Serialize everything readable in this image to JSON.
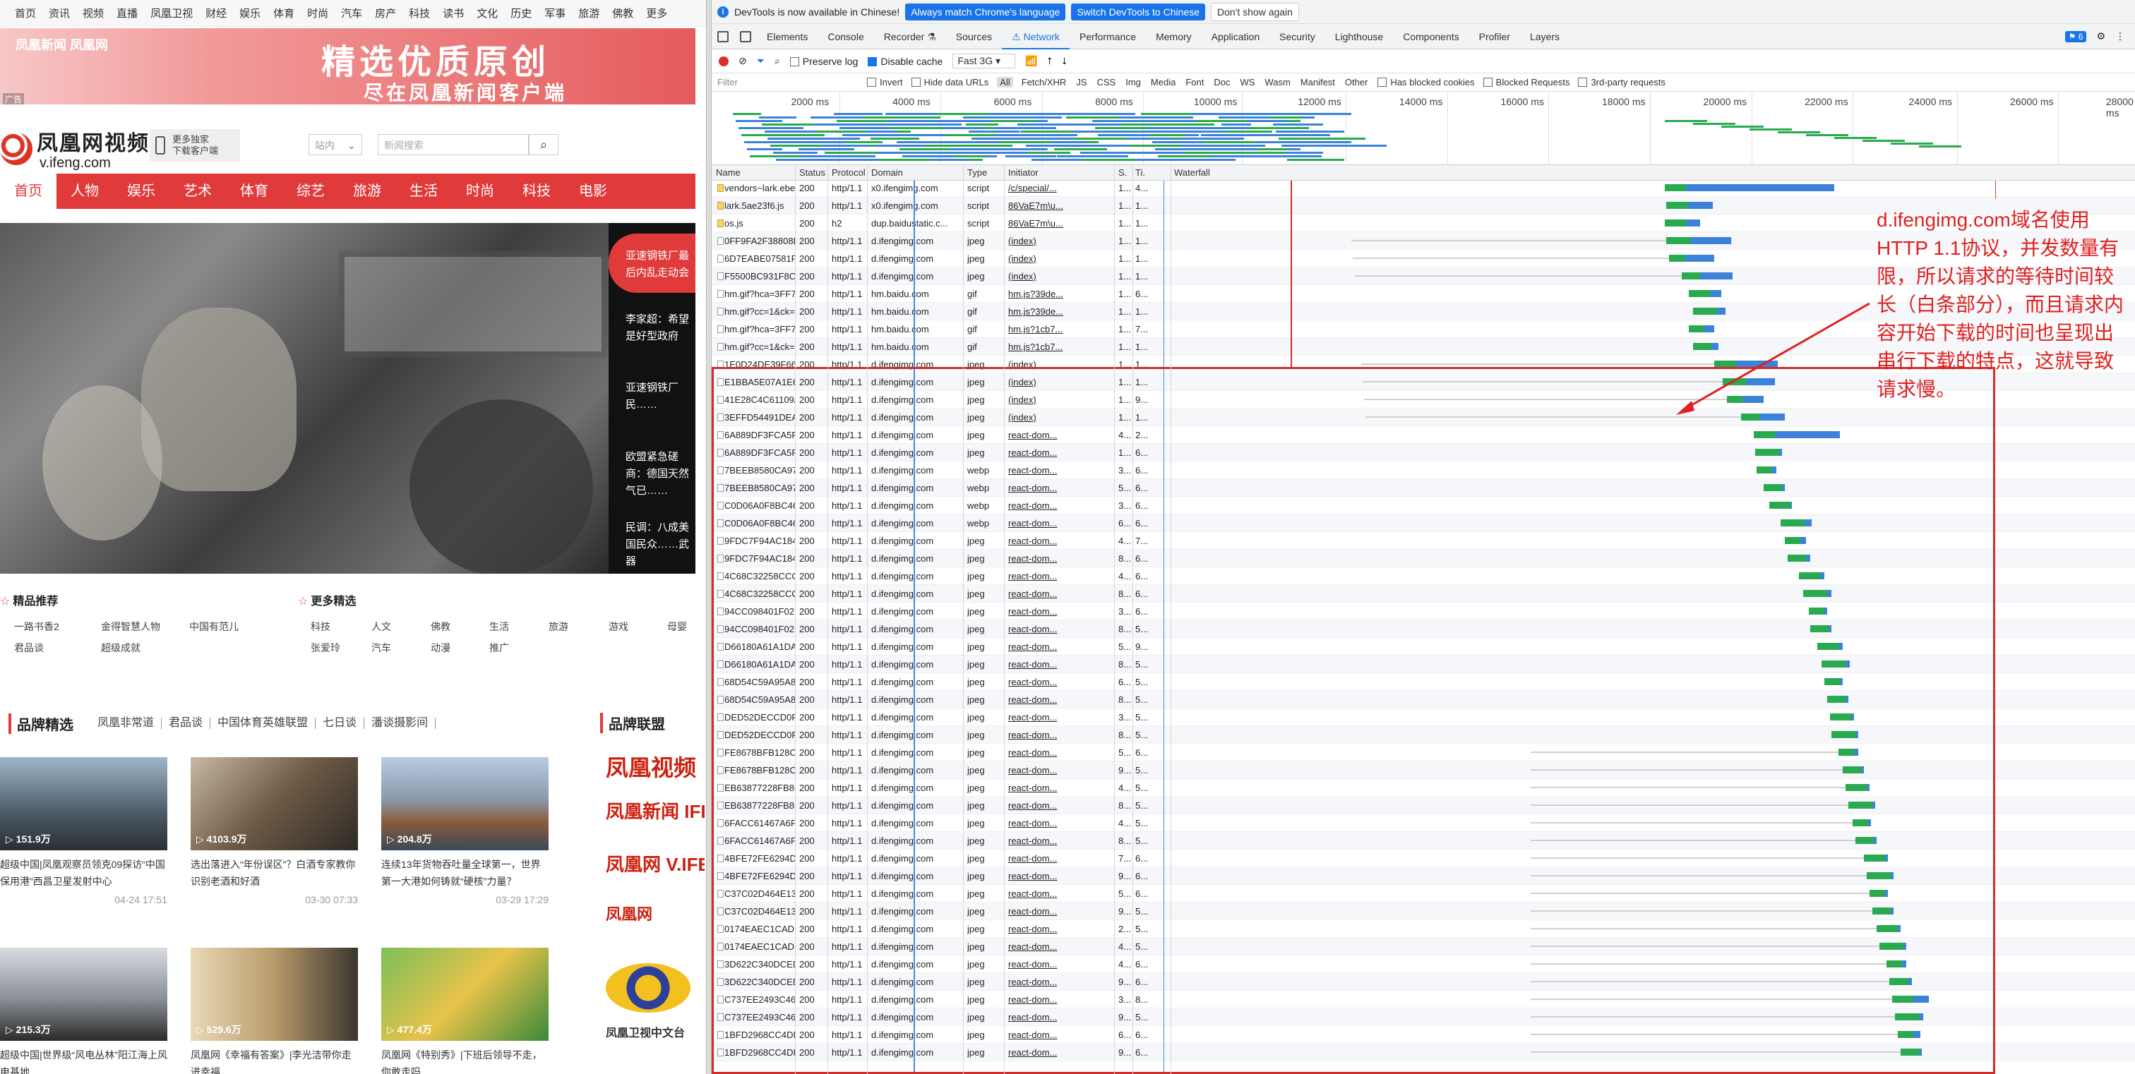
{
  "site": {
    "topnav": [
      "首页",
      "资讯",
      "视频",
      "直播",
      "凤凰卫视",
      "财经",
      "娱乐",
      "体育",
      "时尚",
      "汽车",
      "房产",
      "科技",
      "读书",
      "文化",
      "历史",
      "军事",
      "旅游",
      "佛教",
      "更多"
    ],
    "banner": {
      "left": "凤凰新闻 凤凰网",
      "main": "精选优质原创",
      "sub": "尽在凤凰新闻客户端",
      "ad": "广告"
    },
    "logo": {
      "name": "凤凰网视频",
      "domain": "v.ifeng.com"
    },
    "download": {
      "line1": "更多独家",
      "line2": "下载客户端"
    },
    "site_select": "站内",
    "search_placeholder": "新闻搜索",
    "rednav": [
      "首页",
      "人物",
      "娱乐",
      "艺术",
      "体育",
      "综艺",
      "旅游",
      "生活",
      "时尚",
      "科技",
      "电影"
    ],
    "side_hot": "亚速钢铁厂最后内乱走动会",
    "side_items": [
      "李家超：希望是好型政府",
      "亚速钢铁厂民……",
      "欧盟紧急磋商：德国天然气已……",
      "民调：八成美国民众……武器"
    ],
    "sec_left_title": "精品推荐",
    "sec_left_items": [
      "一路书香2",
      "金得智慧人物",
      "中国有范儿",
      "君品谈",
      "超级成就"
    ],
    "sec_right_title": "更多精选",
    "sec_right_items": [
      "科技",
      "人文",
      "佛教",
      "生活",
      "旅游",
      "游戏",
      "母婴",
      "张爱玲",
      "汽车",
      "动漫",
      "推广"
    ],
    "brand_title": "品牌精选",
    "brand_links": [
      "凤凰非常道",
      "君品谈",
      "中国体育英雄联盟",
      "七日谈",
      "潘谈摄影间"
    ],
    "brand_union": "品牌联盟",
    "cards": [
      {
        "count": "151.9万",
        "cap": "超级中国|凤凰观察员领克09探访“中国保用港”西昌卫星发射中心",
        "date": "04-24 17:51"
      },
      {
        "count": "4103.9万",
        "cap": "选出落进入“年份误区”？白酒专家教你识别老酒和好酒",
        "date": "03-30 07:33"
      },
      {
        "count": "204.8万",
        "cap": "连续13年货物吞吐量全球第一，世界第一大港如何铸就“硬核”力量？",
        "date": "03-29 17:29"
      },
      {
        "count": "215.3万",
        "cap": "超级中国|世界级“风电丛林”阳江海上风电基地",
        "date": ""
      },
      {
        "count": "529.6万",
        "cap": "凤凰网《幸福有答案》|李光洁带你走进幸福",
        "date": ""
      },
      {
        "count": "477.4万",
        "cap": "凤凰网《特别秀》|下班后领导不走，你敢走吗",
        "date": ""
      }
    ],
    "brand_logos": [
      "凤凰视频",
      "凤凰新闻 IFENG NEWS",
      "凤凰网 V.IFENG",
      "凤凰网",
      "凤凰卫视中文台"
    ]
  },
  "devtools": {
    "infobar": {
      "text": "DevTools is now available in Chinese!",
      "btn1": "Always match Chrome's language",
      "btn2": "Switch DevTools to Chinese",
      "btn3": "Don't show again"
    },
    "tabs": [
      "Elements",
      "Console",
      "Recorder ⚗",
      "Sources",
      "⚠ Network",
      "Performance",
      "Memory",
      "Application",
      "Security",
      "Lighthouse",
      "Components",
      "Profiler",
      "Layers"
    ],
    "badge": "6",
    "toolbar": {
      "preserve": "Preserve log",
      "disable": "Disable cache",
      "throttle": "Fast 3G"
    },
    "filter": {
      "placeholder": "Filter",
      "invert": "Invert",
      "hide_data": "Hide data URLs",
      "types": [
        "All",
        "Fetch/XHR",
        "JS",
        "CSS",
        "Img",
        "Media",
        "Font",
        "Doc",
        "WS",
        "Wasm",
        "Manifest",
        "Other"
      ],
      "blocked_cookies": "Has blocked cookies",
      "blocked_requests": "Blocked Requests",
      "third_party": "3rd-party requests"
    },
    "ticks": [
      "2000 ms",
      "4000 ms",
      "6000 ms",
      "8000 ms",
      "10000 ms",
      "12000 ms",
      "14000 ms",
      "16000 ms",
      "18000 ms",
      "20000 ms",
      "22000 ms",
      "24000 ms",
      "26000 ms",
      "28000 ms"
    ],
    "headers": [
      "Name",
      "Status",
      "Protocol",
      "Domain",
      "Type",
      "Initiator",
      "S.",
      "Ti.",
      "Waterfall"
    ],
    "annotation": "d.ifengimg.com域名使用HTTP 1.1协议，并发数量有限，所以请求的等待时间较长（白条部分），而且请求内容开始下载的时间也呈现出串行下载的特点，这就导致请求慢。",
    "rows": [
      [
        "vendors~lark.ebe9673...",
        "200",
        "http/1.1",
        "x0.ifengimg.com",
        "script",
        "/c/special/...",
        "1...",
        "4..."
      ],
      [
        "lark.5ae23f6.js",
        "200",
        "http/1.1",
        "x0.ifengimg.com",
        "script",
        "86VaE7m\\u...",
        "1...",
        "1..."
      ],
      [
        "os.js",
        "200",
        "h2",
        "dup.baidustatic.c...",
        "script",
        "86VaE7m\\u...",
        "1...",
        "1..."
      ],
      [
        "0FF9FA2F38808DA9E8...",
        "200",
        "http/1.1",
        "d.ifengimg.com",
        "jpeg",
        "(index)",
        "1...",
        "1..."
      ],
      [
        "6D7EABE07581FBA65...",
        "200",
        "http/1.1",
        "d.ifengimg.com",
        "jpeg",
        "(index)",
        "1...",
        "1..."
      ],
      [
        "F5500BC931F8CA887...",
        "200",
        "http/1.1",
        "d.ifengimg.com",
        "jpeg",
        "(index)",
        "1...",
        "1..."
      ],
      [
        "hm.gif?hca=3FF7DA1...",
        "200",
        "http/1.1",
        "hm.baidu.com",
        "gif",
        "hm.js?39de...",
        "1...",
        "6..."
      ],
      [
        "hm.gif?cc=1&ck=1&cl...",
        "200",
        "http/1.1",
        "hm.baidu.com",
        "gif",
        "hm.js?39de...",
        "1...",
        "1..."
      ],
      [
        "hm.gif?hca=3FF7DA1...",
        "200",
        "http/1.1",
        "hm.baidu.com",
        "gif",
        "hm.js?1cb7...",
        "1...",
        "7..."
      ],
      [
        "hm.gif?cc=1&ck=1&cl...",
        "200",
        "http/1.1",
        "hm.baidu.com",
        "gif",
        "hm.js?1cb7...",
        "1...",
        "1..."
      ],
      [
        "1E0D24DE39F664A94...",
        "200",
        "http/1.1",
        "d.ifengimg.com",
        "jpeg",
        "(index)",
        "1...",
        "1..."
      ],
      [
        "E1BBA5E07A1E675967...",
        "200",
        "http/1.1",
        "d.ifengimg.com",
        "jpeg",
        "(index)",
        "1...",
        "1..."
      ],
      [
        "41E28C4C61109AF729...",
        "200",
        "http/1.1",
        "d.ifengimg.com",
        "jpeg",
        "(index)",
        "1...",
        "9..."
      ],
      [
        "3EFFD54491DEADC38...",
        "200",
        "http/1.1",
        "d.ifengimg.com",
        "jpeg",
        "(index)",
        "1...",
        "1..."
      ],
      [
        "6A889DF3FCA5F6936...",
        "200",
        "http/1.1",
        "d.ifengimg.com",
        "jpeg",
        "react-dom...",
        "4...",
        "2..."
      ],
      [
        "6A889DF3FCA5F6936...",
        "200",
        "http/1.1",
        "d.ifengimg.com",
        "jpeg",
        "react-dom...",
        "1...",
        "6..."
      ],
      [
        "7BEEB8580CA9790229...",
        "200",
        "http/1.1",
        "d.ifengimg.com",
        "webp",
        "react-dom...",
        "3...",
        "6..."
      ],
      [
        "7BEEB8580CA9790229...",
        "200",
        "http/1.1",
        "d.ifengimg.com",
        "webp",
        "react-dom...",
        "5...",
        "6..."
      ],
      [
        "C0D06A0F8BC4648F8...",
        "200",
        "http/1.1",
        "d.ifengimg.com",
        "webp",
        "react-dom...",
        "3...",
        "6..."
      ],
      [
        "C0D06A0F8BC4648F8...",
        "200",
        "http/1.1",
        "d.ifengimg.com",
        "webp",
        "react-dom...",
        "6...",
        "6..."
      ],
      [
        "9FDC7F94AC184CA42...",
        "200",
        "http/1.1",
        "d.ifengimg.com",
        "jpeg",
        "react-dom...",
        "4...",
        "7..."
      ],
      [
        "9FDC7F94AC184CA42...",
        "200",
        "http/1.1",
        "d.ifengimg.com",
        "jpeg",
        "react-dom...",
        "8...",
        "6..."
      ],
      [
        "4C68C32258CCCEC27...",
        "200",
        "http/1.1",
        "d.ifengimg.com",
        "jpeg",
        "react-dom...",
        "4...",
        "6..."
      ],
      [
        "4C68C32258CCCEC27...",
        "200",
        "http/1.1",
        "d.ifengimg.com",
        "jpeg",
        "react-dom...",
        "8...",
        "6..."
      ],
      [
        "94CC098401F02D599...",
        "200",
        "http/1.1",
        "d.ifengimg.com",
        "jpeg",
        "react-dom...",
        "3...",
        "6..."
      ],
      [
        "94CC098401F02D599...",
        "200",
        "http/1.1",
        "d.ifengimg.com",
        "jpeg",
        "react-dom...",
        "8...",
        "5..."
      ],
      [
        "D66180A61A1DAC860...",
        "200",
        "http/1.1",
        "d.ifengimg.com",
        "jpeg",
        "react-dom...",
        "5...",
        "9..."
      ],
      [
        "D66180A61A1DAC860...",
        "200",
        "http/1.1",
        "d.ifengimg.com",
        "jpeg",
        "react-dom...",
        "8...",
        "5..."
      ],
      [
        "68D54C59A95A871CC...",
        "200",
        "http/1.1",
        "d.ifengimg.com",
        "jpeg",
        "react-dom...",
        "6...",
        "5..."
      ],
      [
        "68D54C59A95A871CC...",
        "200",
        "http/1.1",
        "d.ifengimg.com",
        "jpeg",
        "react-dom...",
        "8...",
        "5..."
      ],
      [
        "DED52DECCD0F8ACF...",
        "200",
        "http/1.1",
        "d.ifengimg.com",
        "jpeg",
        "react-dom...",
        "3...",
        "5..."
      ],
      [
        "DED52DECCD0F8ACF...",
        "200",
        "http/1.1",
        "d.ifengimg.com",
        "jpeg",
        "react-dom...",
        "8...",
        "5..."
      ],
      [
        "FE8678BFB128CD2714...",
        "200",
        "http/1.1",
        "d.ifengimg.com",
        "jpeg",
        "react-dom...",
        "5...",
        "6..."
      ],
      [
        "FE8678BFB128CD2714...",
        "200",
        "http/1.1",
        "d.ifengimg.com",
        "jpeg",
        "react-dom...",
        "9...",
        "5..."
      ],
      [
        "EB63877228FB866B9...",
        "200",
        "http/1.1",
        "d.ifengimg.com",
        "jpeg",
        "react-dom...",
        "4...",
        "5..."
      ],
      [
        "EB63877228FB866B9...",
        "200",
        "http/1.1",
        "d.ifengimg.com",
        "jpeg",
        "react-dom...",
        "8...",
        "5..."
      ],
      [
        "6FACC61467A6F20660...",
        "200",
        "http/1.1",
        "d.ifengimg.com",
        "jpeg",
        "react-dom...",
        "4...",
        "5..."
      ],
      [
        "6FACC61467A6F20660...",
        "200",
        "http/1.1",
        "d.ifengimg.com",
        "jpeg",
        "react-dom...",
        "8...",
        "5..."
      ],
      [
        "4BFE72FE6294D2CE8F...",
        "200",
        "http/1.1",
        "d.ifengimg.com",
        "jpeg",
        "react-dom...",
        "7...",
        "6..."
      ],
      [
        "4BFE72FE6294D2CE8F...",
        "200",
        "http/1.1",
        "d.ifengimg.com",
        "jpeg",
        "react-dom...",
        "9...",
        "6..."
      ],
      [
        "C37C02D464E138848...",
        "200",
        "http/1.1",
        "d.ifengimg.com",
        "jpeg",
        "react-dom...",
        "5...",
        "6..."
      ],
      [
        "C37C02D464E138848...",
        "200",
        "http/1.1",
        "d.ifengimg.com",
        "jpeg",
        "react-dom...",
        "9...",
        "5..."
      ],
      [
        "0174EAEC1CAD11DE4...",
        "200",
        "http/1.1",
        "d.ifengimg.com",
        "jpeg",
        "react-dom...",
        "2...",
        "5..."
      ],
      [
        "0174EAEC1CAD11DE4...",
        "200",
        "http/1.1",
        "d.ifengimg.com",
        "jpeg",
        "react-dom...",
        "4...",
        "5..."
      ],
      [
        "3D622C340DCED8DA...",
        "200",
        "http/1.1",
        "d.ifengimg.com",
        "jpeg",
        "react-dom...",
        "4...",
        "6..."
      ],
      [
        "3D622C340DCED8DA...",
        "200",
        "http/1.1",
        "d.ifengimg.com",
        "jpeg",
        "react-dom...",
        "9...",
        "6..."
      ],
      [
        "C737EE2493C46401A8...",
        "200",
        "http/1.1",
        "d.ifengimg.com",
        "jpeg",
        "react-dom...",
        "3...",
        "8..."
      ],
      [
        "C737EE2493C46401A8...",
        "200",
        "http/1.1",
        "d.ifengimg.com",
        "jpeg",
        "react-dom...",
        "9...",
        "5..."
      ],
      [
        "1BFD2968CC4DF7193...",
        "200",
        "http/1.1",
        "d.ifengimg.com",
        "jpeg",
        "react-dom...",
        "6...",
        "6..."
      ],
      [
        "1BFD2968CC4DF7193...",
        "200",
        "http/1.1",
        "d.ifengimg.com",
        "jpeg",
        "react-dom...",
        "9...",
        "6..."
      ]
    ],
    "colors": {
      "blue": "#1a73e8",
      "green": "#2aaa4f",
      "red": "#e02020"
    }
  }
}
